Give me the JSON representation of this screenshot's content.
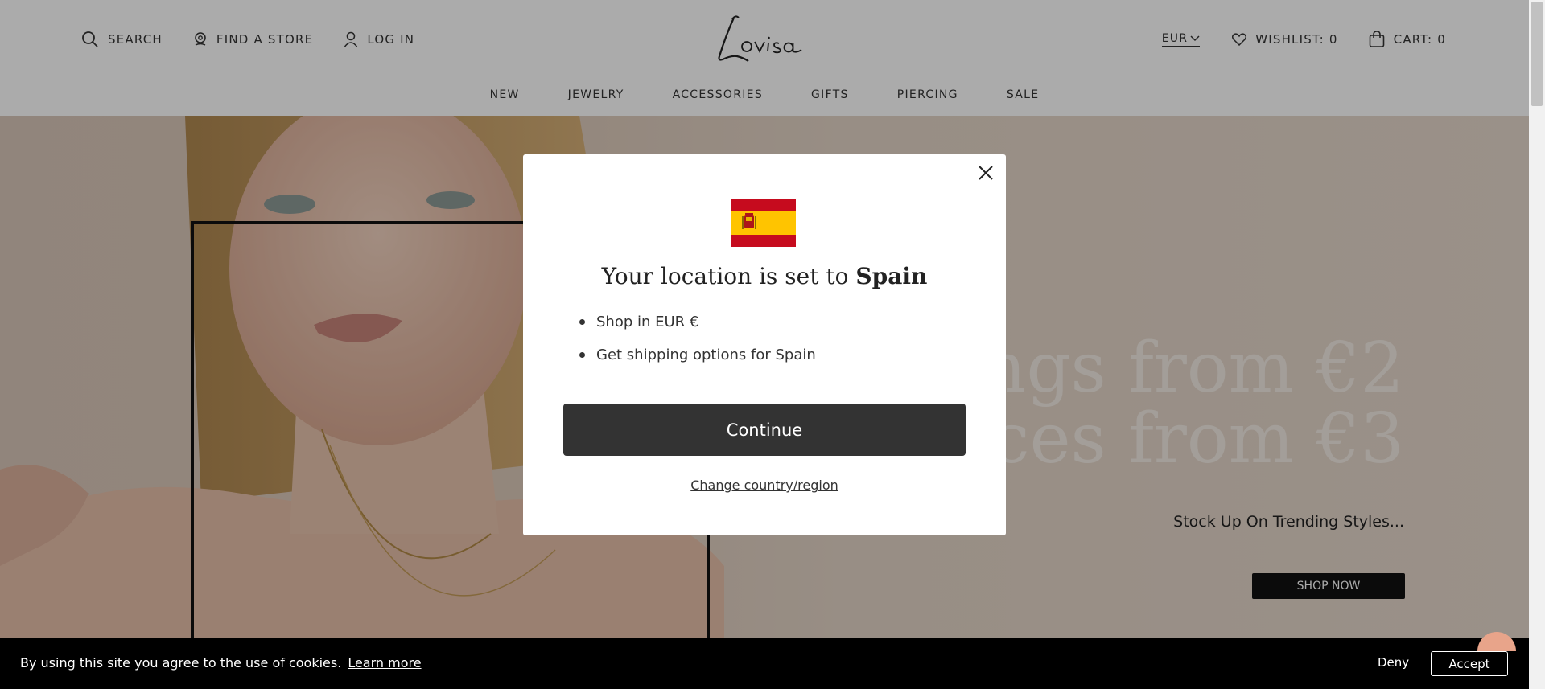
{
  "header": {
    "search_label": "SEARCH",
    "find_store_label": "FIND A STORE",
    "login_label": "LOG IN",
    "logo_text": "Lovisa",
    "currency_label": "EUR",
    "wishlist_label": "WISHLIST: 0",
    "cart_label": "CART: 0"
  },
  "nav": {
    "items": [
      "NEW",
      "JEWELRY",
      "ACCESSORIES",
      "GIFTS",
      "PIERCING",
      "SALE"
    ]
  },
  "hero": {
    "headline_line1": "rings from €2",
    "headline_line2": "aces from €3",
    "subline": "Stock Up On Trending Styles...",
    "cta_label": "SHOP NOW"
  },
  "modal": {
    "title_prefix": "Your location is set to ",
    "title_country": "Spain",
    "bullets": [
      "Shop in EUR €",
      "Get shipping options for Spain"
    ],
    "continue_label": "Continue",
    "change_label": "Change country/region"
  },
  "cookie": {
    "text": "By using this site you agree to the use of cookies.",
    "learn_more": "Learn more",
    "deny_label": "Deny",
    "accept_label": "Accept"
  },
  "colors": {
    "flag_red": "#c60b1e",
    "flag_yellow": "#ffc400",
    "button_dark": "#333333",
    "cookie_bg": "#000000"
  },
  "icons": [
    "search-icon",
    "map-pin-icon",
    "user-icon",
    "chevron-down-icon",
    "heart-icon",
    "bag-icon",
    "close-icon"
  ]
}
